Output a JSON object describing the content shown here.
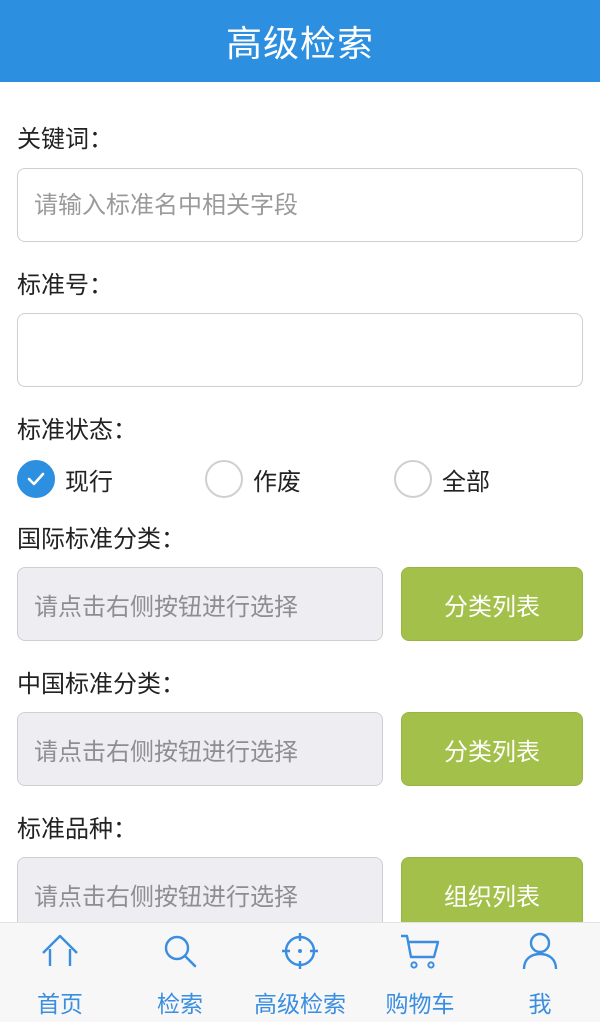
{
  "header": {
    "title": "高级检索"
  },
  "form": {
    "keyword": {
      "label": "关键词：",
      "value": "",
      "placeholder": "请输入标准名中相关字段"
    },
    "standard_no": {
      "label": "标准号：",
      "value": "",
      "placeholder": ""
    },
    "status": {
      "label": "标准状态：",
      "options": [
        "现行",
        "作废",
        "全部"
      ],
      "selected": "现行"
    },
    "intl_category": {
      "label": "国际标准分类：",
      "placeholder": "请点击右侧按钮进行选择",
      "button": "分类列表"
    },
    "cn_category": {
      "label": "中国标准分类：",
      "placeholder": "请点击右侧按钮进行选择",
      "button": "分类列表"
    },
    "variety": {
      "label": "标准品种：",
      "placeholder": "请点击右侧按钮进行选择",
      "button": "组织列表"
    }
  },
  "tabbar": {
    "items": [
      {
        "label": "首页",
        "icon": "home-icon"
      },
      {
        "label": "检索",
        "icon": "search-icon"
      },
      {
        "label": "高级检索",
        "icon": "crosshair-icon",
        "active": true
      },
      {
        "label": "购物车",
        "icon": "cart-icon"
      },
      {
        "label": "我",
        "icon": "user-icon"
      }
    ]
  },
  "colors": {
    "header": "#2d8fe0",
    "button": "#a3c14a",
    "tab_text": "#3a8ee0",
    "radio_checked": "#2d8fe0"
  }
}
